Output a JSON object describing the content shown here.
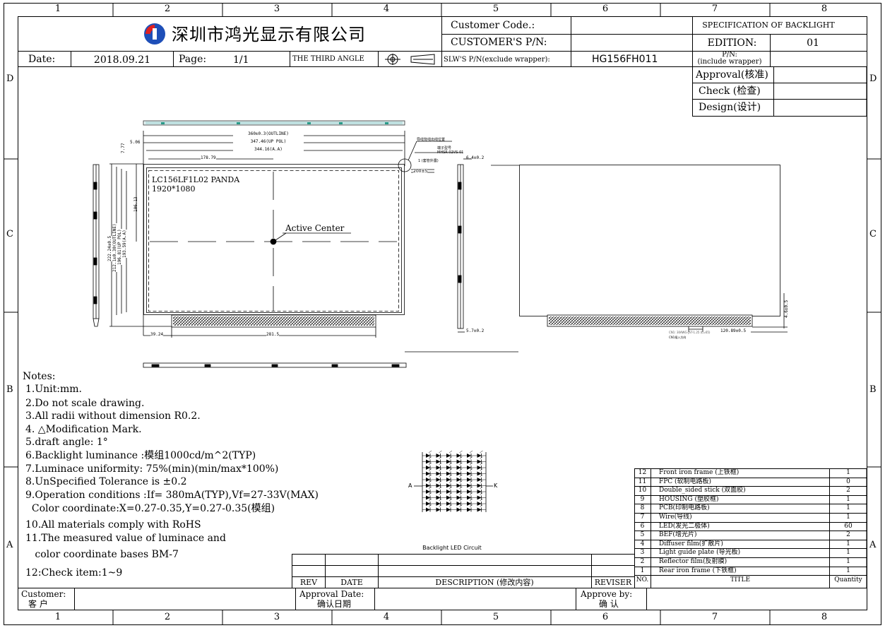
{
  "ruler": {
    "cols": [
      "1",
      "2",
      "3",
      "4",
      "5",
      "6",
      "7",
      "8"
    ],
    "rows": [
      "D",
      "C",
      "B",
      "A"
    ]
  },
  "header": {
    "company": "深圳市鸿光显示有限公司",
    "customer_code_label": "Customer Code.:",
    "customer_pn_label": "CUSTOMER'S P/N:",
    "spec_title": "SPECIFICATION OF BACKLIGHT",
    "edition_label": "EDITION:",
    "edition_value": "01",
    "date_label": "Date:",
    "date_value": "2018.09.21",
    "page_label": "Page:",
    "page_value": "1/1",
    "projection": "THE THIRD ANGLE",
    "slw_pn_label": "SLW'S P/N(exclude wrapper):",
    "slw_pn_value": "HG156FH011",
    "pn_include_label": "P/N:",
    "pn_include_sub": "(include wrapper)"
  },
  "approval": {
    "approval": "Approval(核准)",
    "check": "Check (检查)",
    "design": "Design(设计)"
  },
  "drawing": {
    "panel_model": "LC156LF1L02  PANDA",
    "panel_res": "1920*1080",
    "active_center": "Active Center",
    "dim_outline_w": "360±0.3(OUTLINE)",
    "dim_pol_w": "347.46(UP POL)",
    "dim_aa_w": "344.16(A.A)",
    "dim_506": "5.06",
    "dim_777": "7.77",
    "dim_1179": "178.79",
    "dim_1006": "106.13",
    "dim_h_out": "222.24±0.5",
    "dim_h_outline": "212.1±0.30(OUTLINE)",
    "dim_h_pol": "196.81(UP POL)",
    "dim_h_aa": "193.59(A.A)",
    "dim_3924": "39.24",
    "dim_2815": "281.5",
    "dim_64": "6.4±0.2",
    "dim_57": "5.7±0.2",
    "dim_46": "4.6±0.5",
    "dim_12089": "120.89±0.5",
    "note_wire": "导线背线出线位置",
    "note_conn": "端子型号",
    "note_conn2": "MHSR-02VS-01",
    "note_200": "200±5",
    "note_1": "1 (套管外露)",
    "note_cn1": "CN1: 30AWG-JST-1.25 (L=65)",
    "note_cn2": "CN1插入方向"
  },
  "notes": {
    "title": "Notes:",
    "items": [
      "1.Unit:mm.",
      "2.Do not scale drawing.",
      "3.All radii without dimension R0.2.",
      "4. △Modification Mark.",
      "5.draft angle: 1°",
      "6.Backlight luminance :模组1000cd/m^2(TYP)",
      "7.Luminace uniformity: 75%(min)(min/max*100%)",
      "8.UnSpecified Tolerance is ±0.2",
      "9.Operation conditions :If= 380mA(TYP),Vf=27-33V(MAX)",
      "  Color coordinate:X=0.27-0.35,Y=0.27-0.35(模组)",
      "10.All materials comply with RoHS",
      "11.The measured value of luminace and",
      "   color coordinate bases BM-7",
      "12:Check item:1~9"
    ]
  },
  "circuit": {
    "title": "Backlight LED Circuit",
    "anode": "A",
    "cathode": "K"
  },
  "revision": {
    "rev": "REV",
    "date": "DATE",
    "description": "DESCRIPTION  (修改内容)",
    "reviser": "REVISER"
  },
  "bom": {
    "no_label": "NO.",
    "title_label": "TITLE",
    "qty_label": "Quantity",
    "rows": [
      {
        "no": "12",
        "title": "Front iron frame     (上铁框)",
        "qty": "1"
      },
      {
        "no": "11",
        "title": "FPC (软制电路板)",
        "qty": "0"
      },
      {
        "no": "10",
        "title": "Double_sided stick  (双面胶)",
        "qty": "2"
      },
      {
        "no": "9",
        "title": "HOUSING  (塑胶框)",
        "qty": "1"
      },
      {
        "no": "8",
        "title": "PCB(印制电路板)",
        "qty": "1"
      },
      {
        "no": "7",
        "title": "Wire(导线)",
        "qty": "1"
      },
      {
        "no": "6",
        "title": "LED(发光二极体)",
        "qty": "60"
      },
      {
        "no": "5",
        "title": "BEF(增光片)",
        "qty": "2"
      },
      {
        "no": "4",
        "title": "Diffuser film(扩散片)",
        "qty": "1"
      },
      {
        "no": "3",
        "title": "Light guide plate  (导光板)",
        "qty": "1"
      },
      {
        "no": "2",
        "title": "Reflector film(反射膜)",
        "qty": "1"
      },
      {
        "no": "1",
        "title": "Rear iron frame  (下铁框)",
        "qty": "1"
      }
    ]
  },
  "footer": {
    "customer": "Customer:",
    "customer_cn": "客  户",
    "approval_date": "Approval Date:",
    "approval_date_cn": "确认日期",
    "approve_by": "Approve by:",
    "approve_by_cn": "确  认"
  }
}
